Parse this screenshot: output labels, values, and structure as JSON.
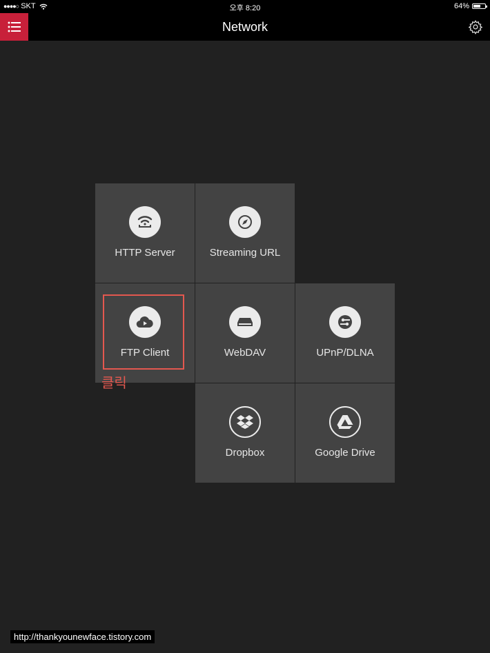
{
  "status_bar": {
    "carrier": "SKT",
    "time": "오후 8:20",
    "battery": "64%",
    "battery_level": 0.64
  },
  "nav": {
    "title": "Network",
    "menu_icon": "list-menu-icon",
    "settings_icon": "gear-icon"
  },
  "tiles": [
    {
      "label": "HTTP Server",
      "icon": "wifi-server-icon"
    },
    {
      "label": "Streaming URL",
      "icon": "compass-icon"
    },
    {
      "label": "FTP Client",
      "icon": "cloud-play-icon"
    },
    {
      "label": "WebDAV",
      "icon": "drive-icon"
    },
    {
      "label": "UPnP/DLNA",
      "icon": "network-share-icon"
    },
    {
      "label": "Dropbox",
      "icon": "dropbox-icon"
    },
    {
      "label": "Google Drive",
      "icon": "google-drive-icon"
    }
  ],
  "annotation": {
    "text": "클릭",
    "color": "#e4584f"
  },
  "watermark": "http://thankyounewface.tistory.com",
  "colors": {
    "accent": "#c8203a",
    "background": "#212121",
    "tile": "#434343"
  }
}
